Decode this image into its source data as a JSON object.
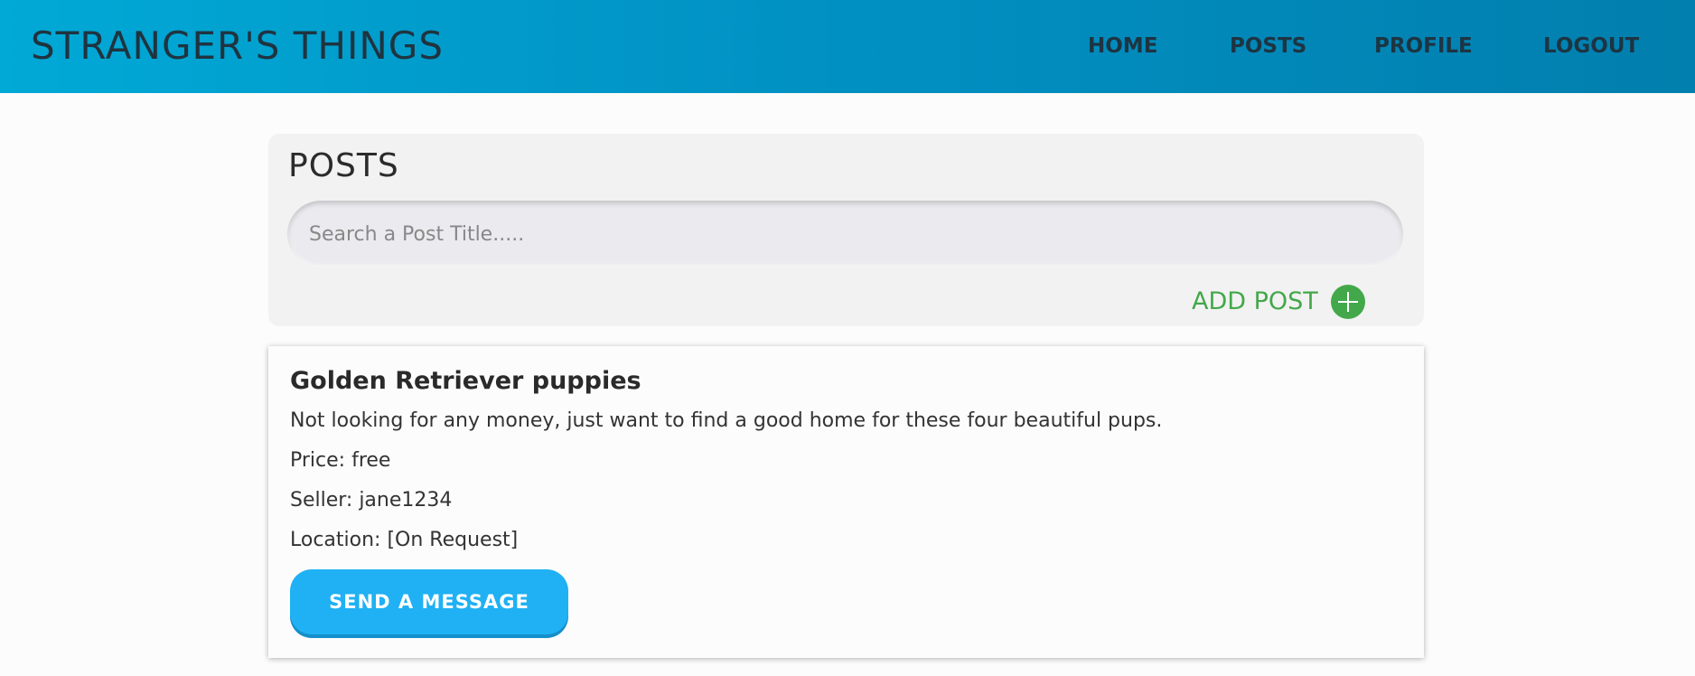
{
  "header": {
    "brand": "STRANGER'S THINGS",
    "nav": {
      "home": "HOME",
      "posts": "POSTS",
      "profile": "PROFILE",
      "logout": "LOGOUT"
    },
    "gradient_colors": [
      "#01a9d6",
      "#017fae"
    ]
  },
  "posts_panel": {
    "title": "POSTS",
    "search_placeholder": "Search a Post Title.....",
    "search_value": "",
    "add_post_label": "ADD POST",
    "add_post_icon": "plus-circle-icon",
    "accent_color": "#43a84a"
  },
  "posts": [
    {
      "title": "Golden Retriever puppies",
      "description": "Not looking for any money, just want to find a good home for these four beautiful pups.",
      "price": "Price: free",
      "seller": "Seller: jane1234",
      "location": "Location: [On Request]",
      "action_label": "SEND A MESSAGE",
      "button_color": "#1fb1f3"
    }
  ]
}
